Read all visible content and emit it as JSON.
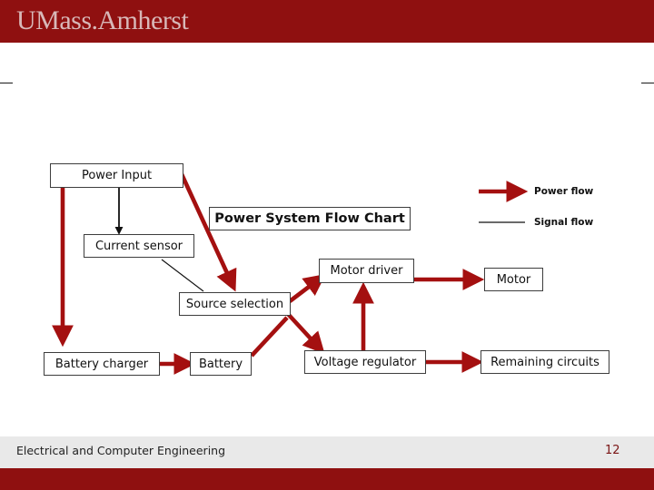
{
  "brand": {
    "logo_text": "UMass.Amherst",
    "band_color": "#8f1010"
  },
  "footer": {
    "department": "Electrical and Computer Engineering",
    "page_number": "12"
  },
  "diagram": {
    "title": "Power System Flow Chart",
    "nodes": [
      {
        "id": "power-input",
        "label": "Power Input"
      },
      {
        "id": "current-sensor",
        "label": "Current sensor"
      },
      {
        "id": "source-selection",
        "label": "Source selection"
      },
      {
        "id": "battery-charger",
        "label": "Battery charger"
      },
      {
        "id": "battery",
        "label": "Battery"
      },
      {
        "id": "motor-driver",
        "label": "Motor driver"
      },
      {
        "id": "motor",
        "label": "Motor"
      },
      {
        "id": "voltage-regulator",
        "label": "Voltage regulator"
      },
      {
        "id": "remaining-circuits",
        "label": "Remaining circuits"
      }
    ],
    "legend": [
      {
        "id": "power-flow",
        "label": "Power flow",
        "color": "#a41010"
      },
      {
        "id": "signal-flow",
        "label": "Signal flow",
        "color": "#000000"
      }
    ],
    "colors": {
      "power_flow": "#a41010",
      "signal_flow": "#000000",
      "node_border": "#3d3d3d"
    }
  }
}
